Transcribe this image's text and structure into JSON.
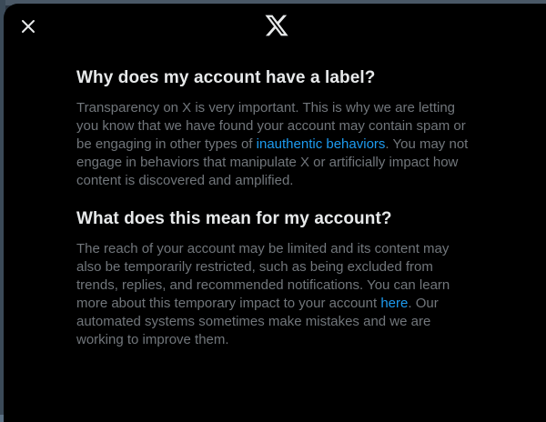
{
  "header": {
    "close_icon": "close-icon",
    "logo_icon": "x-logo-icon"
  },
  "section1": {
    "title": "Why does my account have a label?",
    "body_before": "Transparency on X is very important. This is why we are letting you know that we have found your account may contain spam or be engaging in other types of ",
    "link": "inauthentic behaviors",
    "body_after": ". You may not engage in behaviors that manipulate X or artificially impact how content is discovered and amplified."
  },
  "section2": {
    "title": "What does this mean for my account?",
    "body_before": "The reach of your account may be limited and its content may also be temporarily restricted, such as being excluded from trends, replies, and recommended notifications. You can learn more about this temporary impact to your account ",
    "link": "here",
    "body_after": ". Our automated systems sometimes make mistakes and we are working to improve them."
  },
  "colors": {
    "background": "#000000",
    "heading": "#e7e9ea",
    "body": "#71767b",
    "link": "#1d9bf0"
  }
}
